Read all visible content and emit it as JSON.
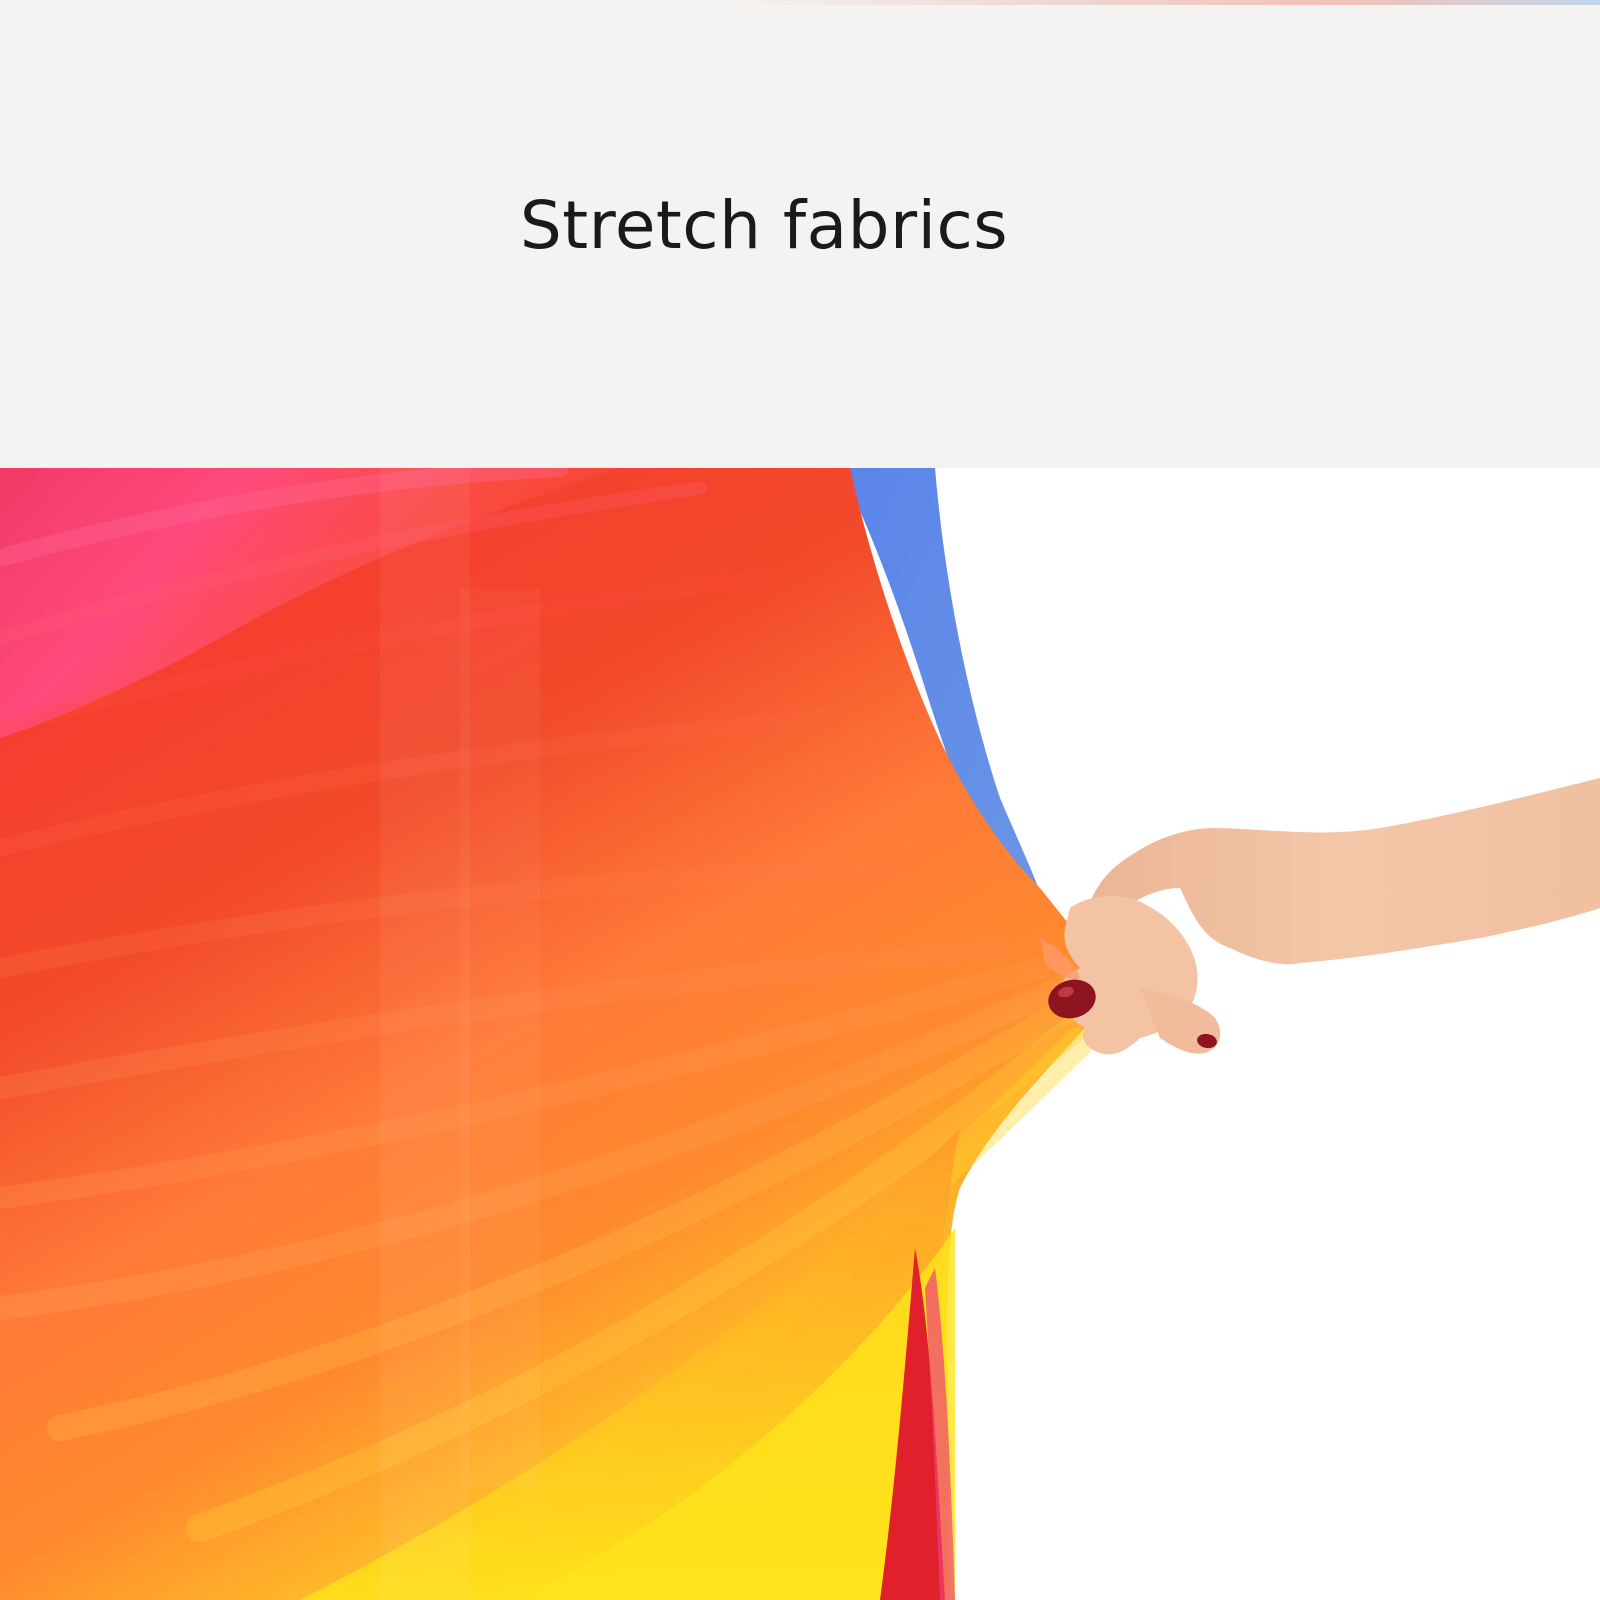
{
  "header": {
    "title": "Stretch fabrics"
  },
  "colors": {
    "header_background": "#f5f3f1",
    "photo_background": "#ffffff",
    "title_text": "#1a1a1a",
    "fabric_red": "#f03a2a",
    "fabric_orange": "#ff7a35",
    "fabric_yellow": "#ffd21a",
    "fabric_pink": "#f0407a",
    "fabric_blue": "#5a86e0",
    "skin": "#f2c2a2",
    "nail_polish": "#8e1420"
  },
  "photo": {
    "subject": "hand-stretching-rainbow-fabric"
  }
}
